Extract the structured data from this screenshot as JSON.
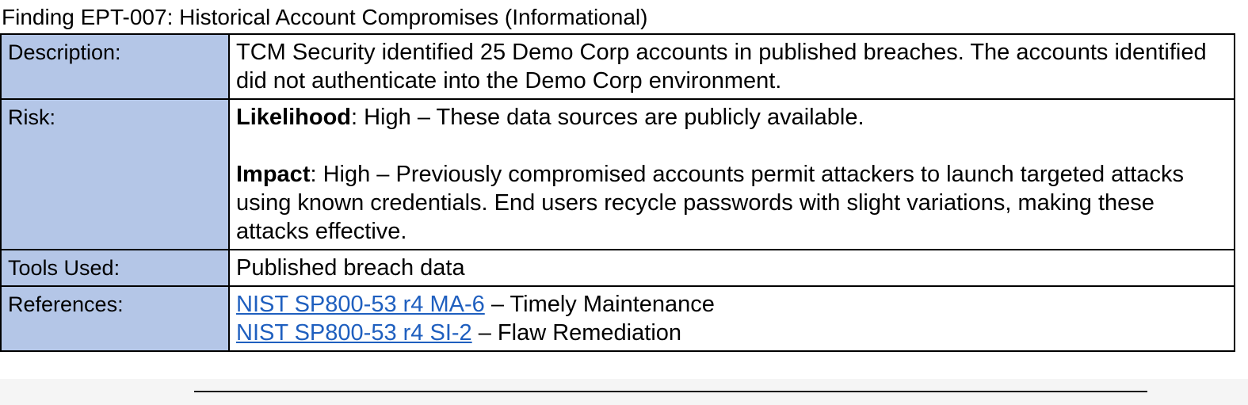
{
  "finding": {
    "title": "Finding EPT-007: Historical Account Compromises (Informational)"
  },
  "rows": {
    "description": {
      "label": "Description:",
      "text": "TCM Security identified 25 Demo Corp accounts in published breaches.  The accounts identified did not authenticate into the Demo Corp environment."
    },
    "risk": {
      "label": "Risk:",
      "likelihood_label": "Likelihood",
      "likelihood_text": ": High – These data sources are publicly available.",
      "impact_label": "Impact",
      "impact_text": ": High – Previously compromised accounts permit attackers to launch targeted attacks using known credentials.  End users recycle passwords with slight variations, making these attacks effective."
    },
    "tools": {
      "label": "Tools Used:",
      "text": "Published breach data"
    },
    "references": {
      "label": "References:",
      "items": [
        {
          "link": "NIST SP800-53 r4 MA-6",
          "suffix": " – Timely Maintenance"
        },
        {
          "link": "NIST SP800-53 r4 SI-2",
          "suffix": " – Flaw Remediation"
        }
      ]
    }
  },
  "colors": {
    "label_background": "#b4c6e7",
    "link": "#1f5fbf"
  }
}
